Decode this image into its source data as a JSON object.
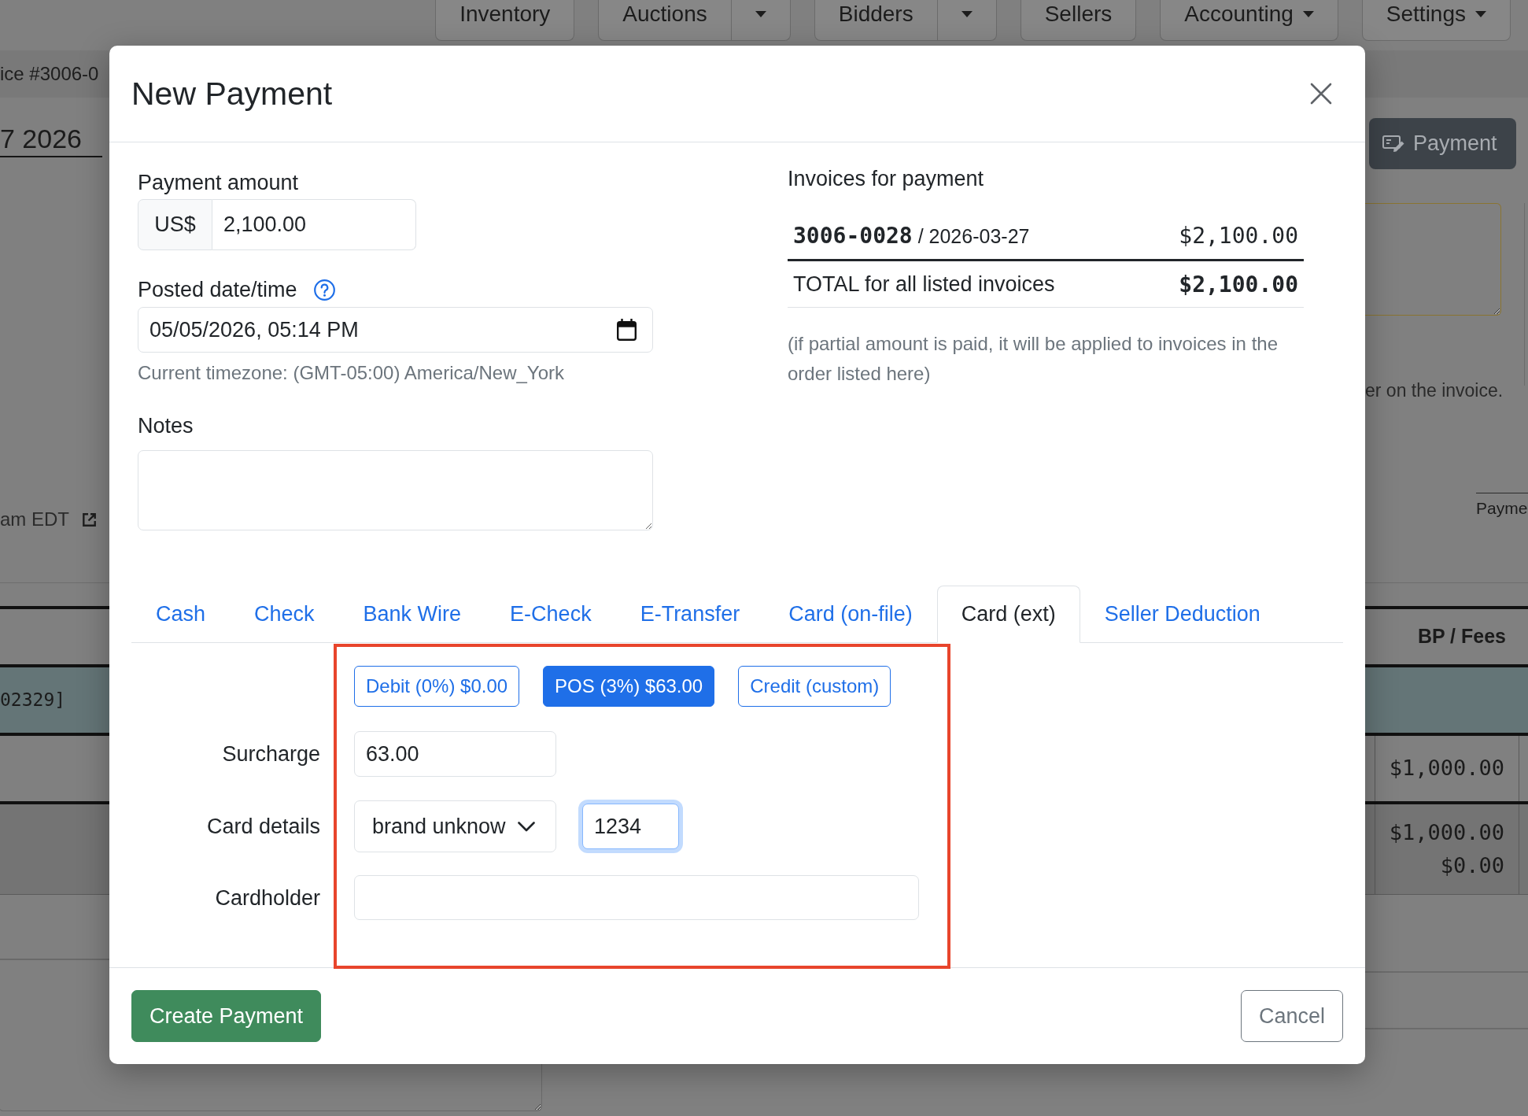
{
  "background_page": {
    "nav_tabs": [
      {
        "label": "Inventory",
        "kind": "plain"
      },
      {
        "label": "Auctions",
        "kind": "split"
      },
      {
        "label": "Bidders",
        "kind": "split"
      },
      {
        "label": "Sellers",
        "kind": "plain"
      },
      {
        "label": "Accounting",
        "kind": "dropdown"
      },
      {
        "label": "Settings",
        "kind": "dropdown"
      }
    ],
    "invoice_title": "ice #3006-0",
    "date_heading": "7 2026",
    "time_text": "am EDT",
    "payment_button": "Payment",
    "note_text": "er on the invoice.",
    "payments_heading": "Payme",
    "table": {
      "columns": [
        {
          "label": "BP / Fees"
        }
      ],
      "rows": [
        {
          "kind": "group",
          "label": "02329]"
        },
        {
          "kind": "item",
          "bp_fees": [
            "$1,000.00"
          ]
        },
        {
          "kind": "total",
          "bp_fees": [
            "$1,000.00",
            "$0.00"
          ]
        }
      ]
    }
  },
  "modal": {
    "title": "New Payment",
    "payment_amount": {
      "label": "Payment amount",
      "prefix": "US$",
      "value": "2,100.00"
    },
    "posted_date": {
      "label": "Posted date/time",
      "value": "05/05/2026, 05:14 PM",
      "timezone": "Current timezone: (GMT-05:00) America/New_York"
    },
    "notes": {
      "label": "Notes"
    },
    "invoices": {
      "title": "Invoices for payment",
      "rows": [
        {
          "label": "**3006-0028** / 2026-03-27",
          "amount": "$2,100.00"
        }
      ],
      "total_label": "TOTAL for all listed invoices",
      "total_amount": "$2,100.00",
      "note": "(if partial amount is paid, it will be applied to invoices in the order listed here)"
    },
    "tabs": [
      {
        "label": "Cash",
        "selected": false
      },
      {
        "label": "Check",
        "selected": false
      },
      {
        "label": "Bank Wire",
        "selected": false
      },
      {
        "label": "E-Check",
        "selected": false
      },
      {
        "label": "E-Transfer",
        "selected": false
      },
      {
        "label": "Card (on-file)",
        "selected": false
      },
      {
        "label": "Card (ext)",
        "selected": true
      },
      {
        "label": "Seller Deduction",
        "selected": false
      }
    ],
    "card_form": {
      "highlighted": true,
      "surcharge_options": [
        {
          "label": "Debit (0%) $0.00",
          "selected": false
        },
        {
          "label": "POS (3%) $63.00",
          "selected": true
        },
        {
          "label": "Credit (custom)",
          "selected": false
        }
      ],
      "surcharge": {
        "label": "Surcharge",
        "value": "63.00"
      },
      "card_details": {
        "label": "Card details",
        "brand": "brand unknow",
        "last4": "1234",
        "last4_focused": true
      },
      "cardholder": {
        "label": "Cardholder"
      }
    },
    "buttons": [
      {
        "label": "Create Payment",
        "kind": "primary"
      },
      {
        "label": "Cancel",
        "kind": "secondary"
      }
    ]
  }
}
